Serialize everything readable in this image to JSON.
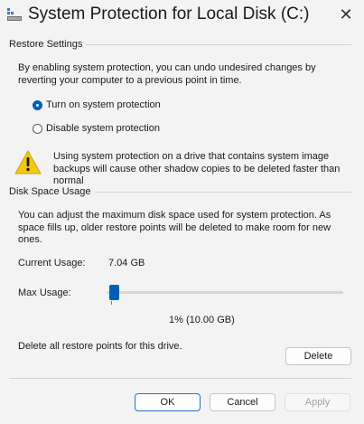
{
  "window": {
    "title": "System Protection for Local Disk (C:)",
    "close_glyph": "✕",
    "app_icon": "system-protection-icon"
  },
  "restore_settings": {
    "heading": "Restore Settings",
    "description_lines": [
      "By enabling system protection, you can undo undesired changes by",
      "reverting your computer to a previous point in time."
    ],
    "options": [
      {
        "label": "Turn on system protection",
        "selected": true
      },
      {
        "label": "Disable system protection",
        "selected": false
      }
    ],
    "warning_icon": "warning-icon",
    "warning_lines": [
      "Using system protection on a drive that contains system image",
      "backups will cause other shadow copies to be deleted faster than",
      "normal"
    ]
  },
  "disk_space": {
    "heading": "Disk Space Usage",
    "description_lines": [
      "You can adjust the maximum disk space used for system protection. As",
      "space fills up, older restore points will be deleted to make room for new",
      "ones."
    ],
    "current_usage_label": "Current Usage:",
    "current_usage_value": "7.04 GB",
    "max_usage_label": "Max Usage:",
    "max_usage_fraction": 0.01,
    "max_usage_readout": "1% (10.00 GB)",
    "delete_text": "Delete all restore points for this drive.",
    "delete_button": "Delete"
  },
  "footer": {
    "ok": "OK",
    "cancel": "Cancel",
    "apply": "Apply"
  },
  "colors": {
    "accent": "#005fb8",
    "background": "#f3f3f3",
    "warning": "#f2c811"
  }
}
